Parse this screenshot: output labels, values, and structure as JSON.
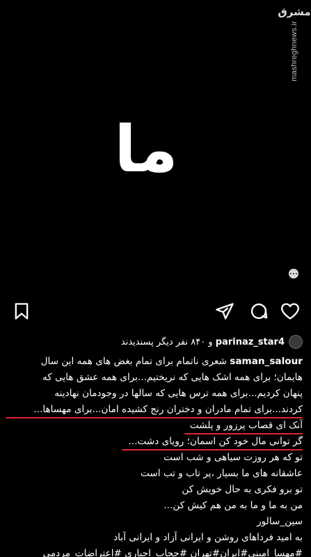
{
  "image": {
    "art_word": "ما",
    "watermark_logo": "مشرق",
    "watermark_url": "mashreghnews.ir"
  },
  "actions": {
    "bookmark_icon": "bookmark-icon",
    "share_icon": "send-icon",
    "comment_icon": "comment-icon",
    "like_icon": "heart-icon"
  },
  "likes": {
    "username": "parinaz_star4",
    "suffix": "و ۸۴۰ نفر دیگر پسندیدند"
  },
  "caption": {
    "username": "saman_salour",
    "lines": [
      "شعری ناتمام برای تمام بغض های همه این سال",
      "هایمان؛ برای همه اشک هایی که نریختیم...برای همه عشق هایی که",
      "پنهان کردیم...برای همه ترس هایی که سالها در وجودمان نهادینه",
      "کردند...برای تمام مادران و دختران رنج کشیده امان...برای مهساها...",
      "آنک ای قصاب پرزور و پلشت",
      "گر توانی مال خود کن اسمان؛ رویای دشت...",
      "تو که هر روزت سیاهی و شب است",
      "عاشقانه های ما بسیار ،پر تاب و تب است",
      "تو برو فکری به حال خویش کن",
      "من به ما و ما به من هم کیش کن...",
      "سین_سالور",
      "به امید فرداهای روشن و ایرانی آزاد و ایرانی آباد",
      "#مهسا_امینی#ایران#تهران #حجاب_اجباری #اعتراضات_مردمی"
    ]
  },
  "colors": {
    "background": "#000000",
    "text": "#ffffff",
    "annotation_underline": "#e0262b"
  }
}
